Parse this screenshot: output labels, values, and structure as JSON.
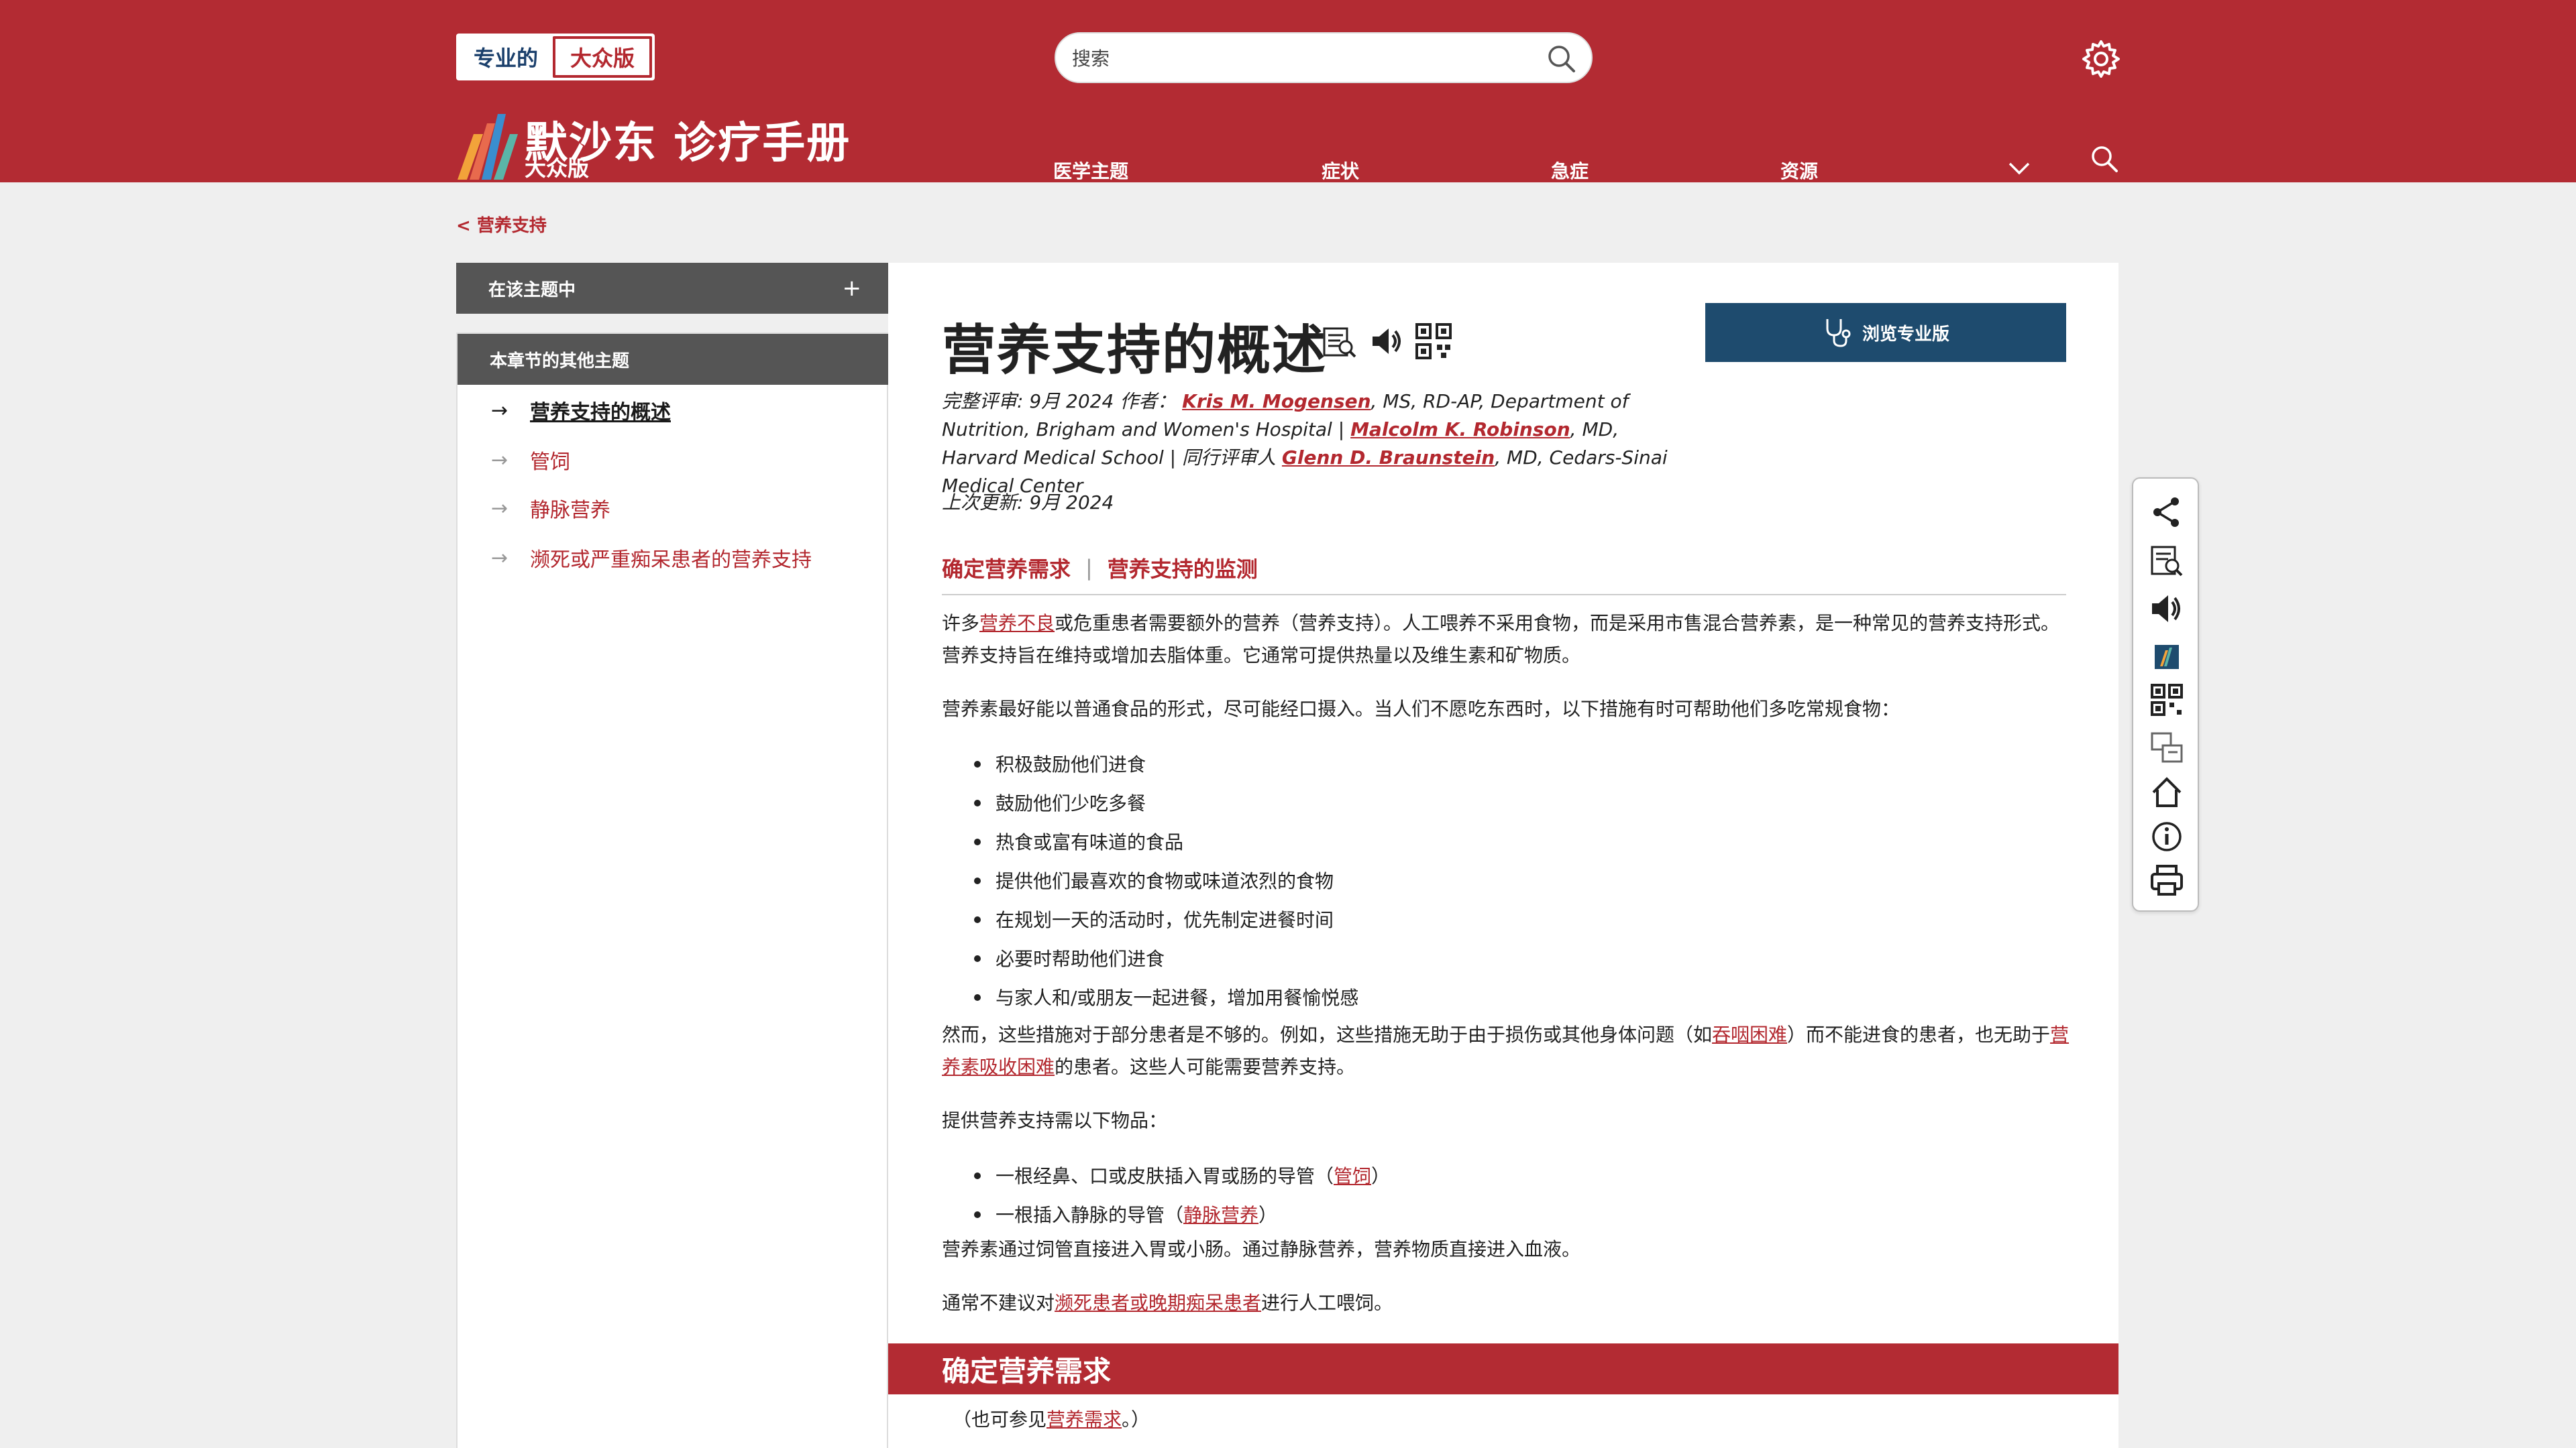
{
  "header": {
    "audience": {
      "professional": "专业的",
      "consumer": "大众版"
    },
    "search": {
      "placeholder": "搜索"
    },
    "brand": {
      "title": "默沙东 诊疗手册",
      "subtitle": "大众版"
    },
    "nav": [
      "医学主题",
      "症状",
      "急症",
      "资源"
    ],
    "icons": {
      "search": "search-icon",
      "settings": "gear-icon",
      "more": "chevron-down-icon"
    }
  },
  "breadcrumb": {
    "back": "< 营养支持"
  },
  "sidebar": {
    "accordion_label": "在该主题中",
    "accordion_toggle": "+",
    "chapter_heading": "本章节的其他主题",
    "items": [
      {
        "arrow": "→",
        "label": "营养支持的概述",
        "active": true
      },
      {
        "arrow": "→",
        "label": "管饲"
      },
      {
        "arrow": "→",
        "label": "静脉营养"
      },
      {
        "arrow": "→",
        "label": "濒死或严重痴呆患者的营养支持"
      }
    ]
  },
  "article": {
    "title": "营养支持的概述",
    "pro_button": "浏览专业版",
    "meta": {
      "review_label": "完整评审: 9月 2024 作者：",
      "author1": "Kris M. Mogensen",
      "author1_affil": ", MS, RD-AP, Department of Nutrition, Brigham and Women's Hospital | ",
      "author2": "Malcolm K. Robinson",
      "author2_affil": ", MD, Harvard Medical School | ",
      "peer_label": "同行评审人 ",
      "reviewer": "Glenn D. Braunstein",
      "reviewer_affil": ", MD, Cedars-Sinai Medical Center"
    },
    "updated": "上次更新: 9月 2024",
    "section_links": [
      "确定营养需求",
      "营养支持的监测"
    ],
    "section_sep": "|",
    "p1": {
      "a": "许多",
      "link": "营养不良",
      "b": "或危重患者需要额外的营养（营养支持）。人工喂养不采用食物，而是采用市售混合营养素，是一种常见的营养支持形式。营养支持旨在维持或增加去脂体重。它通常可提供热量以及维生素和矿物质。"
    },
    "p2": "营养素最好能以普通食品的形式，尽可能经口摄入。当人们不愿吃东西时，以下措施有时可帮助他们多吃常规食物：",
    "list1": [
      "积极鼓励他们进食",
      "鼓励他们少吃多餐",
      "热食或富有味道的食品",
      "提供他们最喜欢的食物或味道浓烈的食物",
      "在规划一天的活动时，优先制定进餐时间",
      "必要时帮助他们进食",
      "与家人和/或朋友一起进餐，增加用餐愉悦感"
    ],
    "p3": {
      "a": "然而，这些措施对于部分患者是不够的。例如，这些措施无助于由于损伤或其他身体问题（如",
      "link1": "吞咽困难",
      "b": "）而不能进食的患者，也无助于",
      "link2": "营养素吸收困难",
      "c": "的患者。这些人可能需要营养支持。"
    },
    "p4": "提供营养支持需以下物品：",
    "list2": [
      {
        "a": "一根经鼻、口或皮肤插入胃或肠的导管（",
        "link": "管饲",
        "b": "）"
      },
      {
        "a": "一根插入静脉的导管（",
        "link": "静脉营养",
        "b": "）"
      }
    ],
    "p5": "营养素通过饲管直接进入胃或小肠。通过静脉营养，营养物质直接进入血液。",
    "p6": {
      "a": "通常不建议对",
      "link": "濒死患者或晚期痴呆患者",
      "b": "进行人工喂饲。"
    },
    "section_heading": "确定营养需求",
    "p7": {
      "a": "（也可参见",
      "link": "营养需求",
      "b": "。）"
    }
  },
  "toolbar": [
    "share-icon",
    "glossary-icon",
    "audio-icon",
    "brand-icon",
    "qr-code-icon",
    "translate-icon",
    "home-icon",
    "info-icon",
    "print-icon"
  ],
  "colors": {
    "brand_red": "#b32b33",
    "pro_blue": "#1e4b6e",
    "sidebar_gray": "#555555"
  }
}
